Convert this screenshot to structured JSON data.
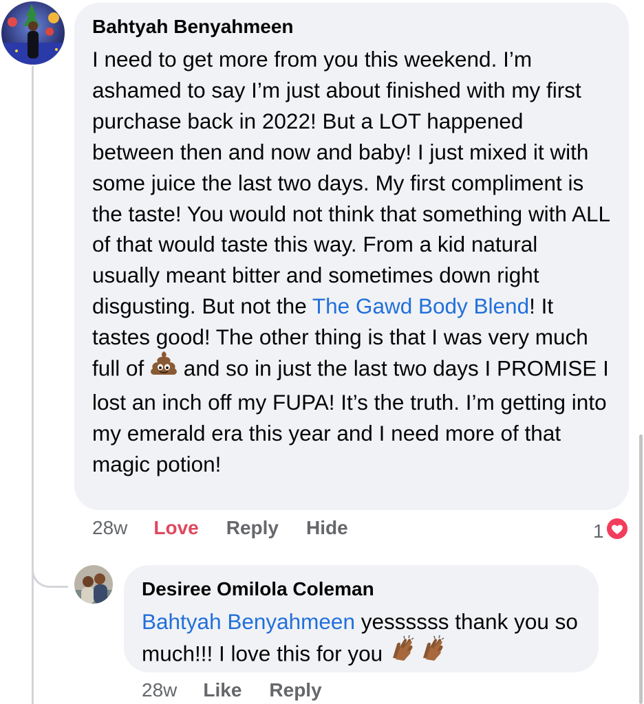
{
  "comments": [
    {
      "author": "Bahtyah Benyahmeen",
      "text_before_link": "I need to get more from you this weekend. I’m ashamed to say I’m just about finished with my first purchase back in 2022! But a LOT happened between then and now and baby! I just mixed it with some juice the last two days. My first compliment is the taste! You would not think that something with ALL of that would taste this way. From a kid natural usually meant bitter and sometimes down right disgusting. But not the ",
      "link_text": "The Gawd Body Blend",
      "text_before_emoji": "! It tastes good! The other thing is that I was very much full of ",
      "emoji": "poop-emoji",
      "text_after_emoji": " and so in just the last two days I PROMISE I lost an inch off my FUPA! It’s the truth. I’m getting into my emerald era this year and I need more of that magic potion!",
      "time": "28w",
      "actions": [
        "Love",
        "Reply",
        "Hide"
      ],
      "reaction_count": "1",
      "reaction_icon": "heart-reaction-icon"
    },
    {
      "author": "Desiree Omilola Coleman",
      "mention": "Bahtyah Benyahmeen",
      "text": " yessssss thank you so much!!! I love this for you ",
      "emoji": "clapping-hands-emoji",
      "time": "28w",
      "actions": [
        "Like",
        "Reply"
      ]
    }
  ],
  "colors": {
    "bubble": "#f0f2f5",
    "link": "#216fdb",
    "love": "#e0475c",
    "meta": "#65676b"
  }
}
